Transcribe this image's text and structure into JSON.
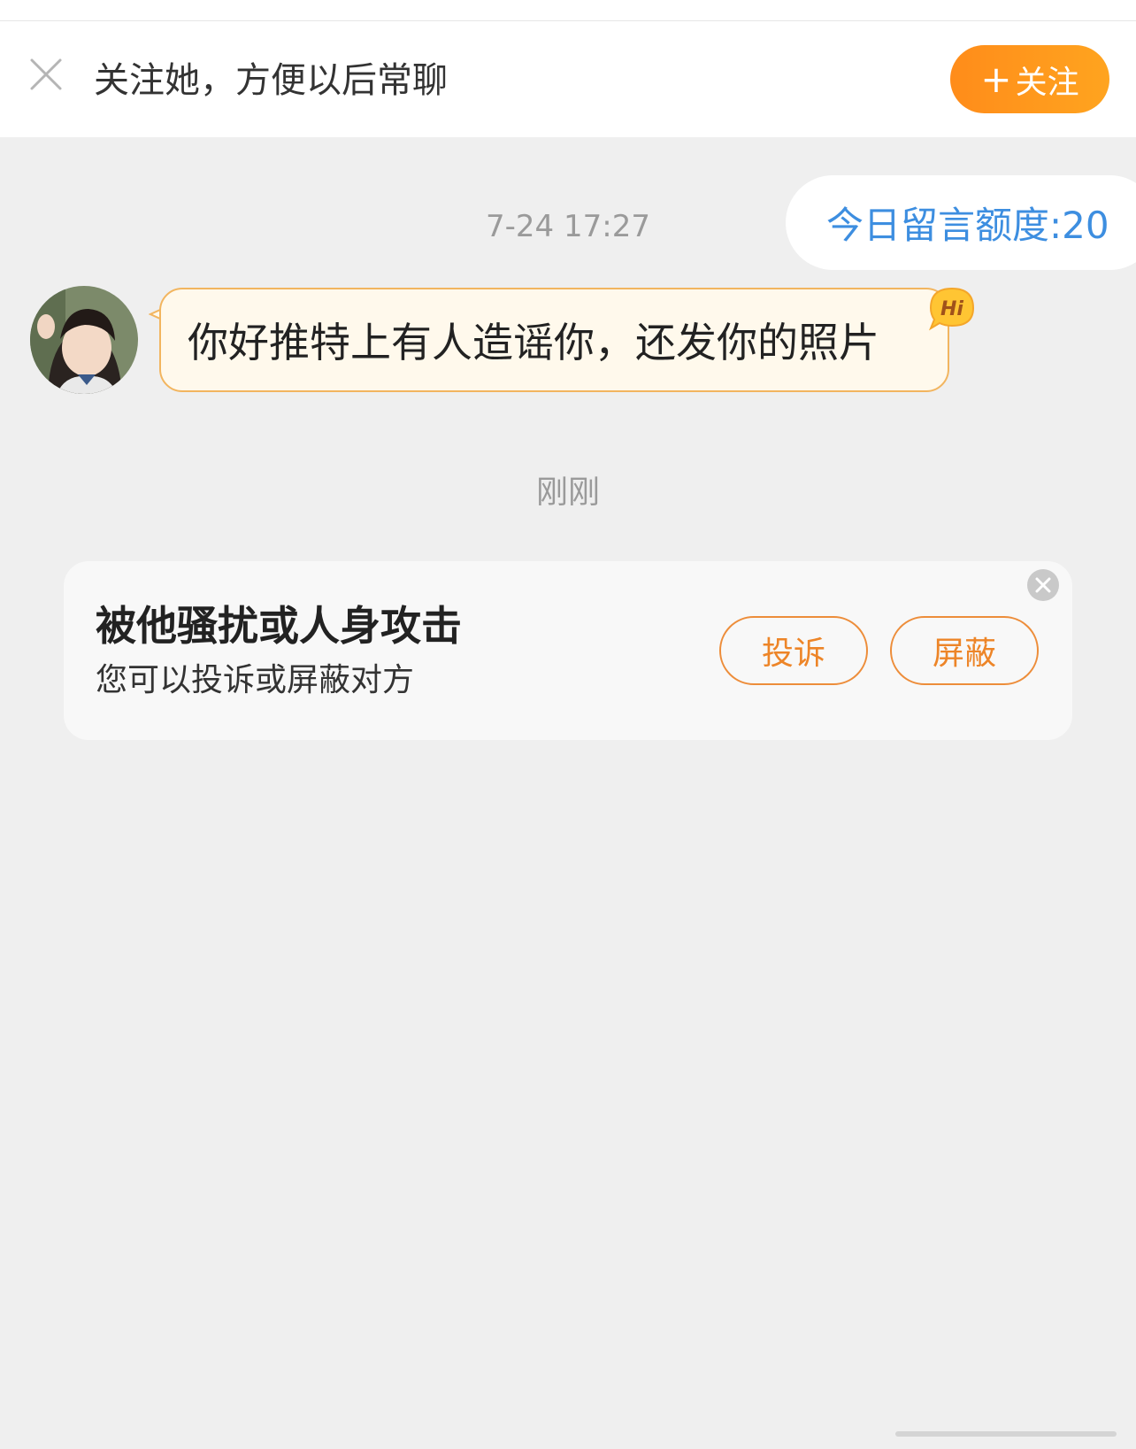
{
  "follow_bar": {
    "prompt_text": "关注她，方便以后常聊",
    "follow_button_plus": "+",
    "follow_button_label": "关注"
  },
  "chat": {
    "quota_label": "今日留言额度:20",
    "timestamp_1": "7-24 17:27",
    "message_text": "你好推特上有人造谣你，还发你的照片",
    "hi_badge": "Hi",
    "timestamp_2": "刚刚"
  },
  "report_card": {
    "title": "被他骚扰或人身攻击",
    "subtitle": "您可以投诉或屏蔽对方",
    "report_button": "投诉",
    "block_button": "屏蔽"
  },
  "icons": {
    "close": "close-icon",
    "card_close": "close-circle-icon",
    "hi": "hi-badge-icon"
  },
  "colors": {
    "accent_orange": "#ff8c1a",
    "quota_blue": "#3d8ee0",
    "bubble_fill": "#fff9ec",
    "bubble_border": "#f2b55f"
  }
}
